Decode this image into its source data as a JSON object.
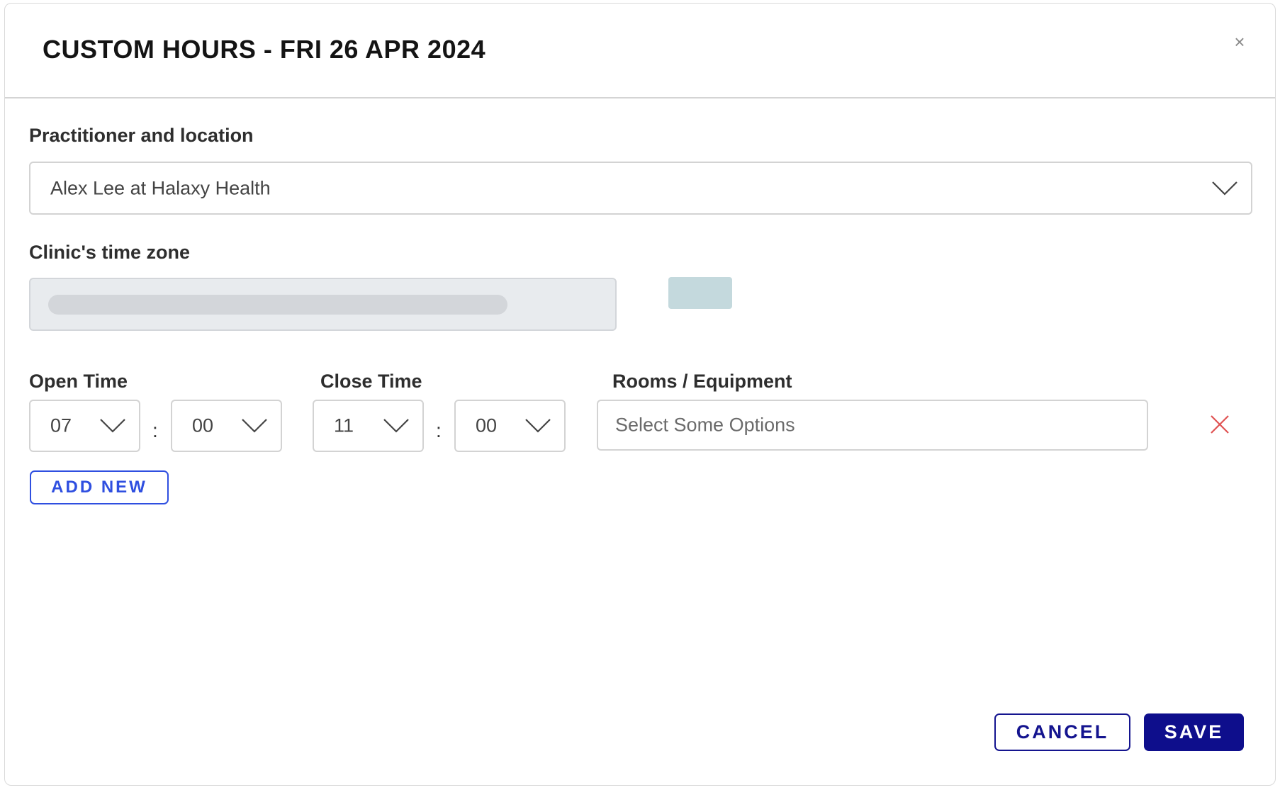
{
  "modal": {
    "title": "CUSTOM HOURS - FRI 26 APR 2024",
    "close_label": "×"
  },
  "practitioner": {
    "label": "Practitioner and location",
    "selected": "Alex Lee at Halaxy Health"
  },
  "timezone": {
    "label": "Clinic's time zone"
  },
  "open_time": {
    "label": "Open Time",
    "hour": "07",
    "minute": "00",
    "separator": ":"
  },
  "close_time": {
    "label": "Close Time",
    "hour": "11",
    "minute": "00",
    "separator": ":"
  },
  "rooms": {
    "label": "Rooms / Equipment",
    "placeholder": "Select Some Options"
  },
  "actions": {
    "add_new": "ADD NEW",
    "cancel": "CANCEL",
    "save": "SAVE"
  },
  "colors": {
    "primary_navy": "#0e0e8c",
    "link_blue": "#2f4fe0",
    "danger_red": "#e05252"
  },
  "icons": {
    "close": "close-icon",
    "chevron": "chevron-down-icon",
    "remove": "remove-icon"
  }
}
